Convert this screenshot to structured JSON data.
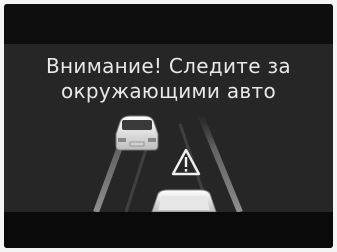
{
  "warning": {
    "line1": "Внимание! Следите за",
    "line2": "окружающими авто"
  },
  "icons": {
    "alert": "warning-triangle-icon",
    "lead_vehicle": "car-rear-icon",
    "own_vehicle": "car-rear-icon"
  },
  "colors": {
    "text": "#e8e8e8",
    "screen": "#262626",
    "frame": "#0b0b0b"
  }
}
